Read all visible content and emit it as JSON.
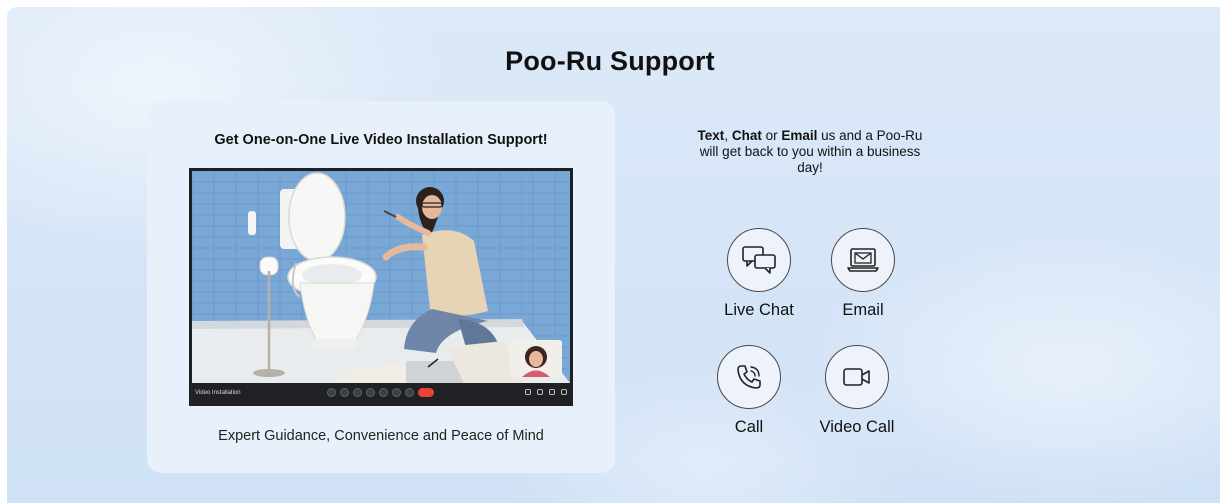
{
  "page": {
    "title": "Poo-Ru Support"
  },
  "video_support": {
    "heading": "Get One-on-One Live Video Installation Support!",
    "caption": "Expert Guidance, Convenience and Peace of Mind",
    "toolbar_label": "Video Installation"
  },
  "contact": {
    "intro_word_1": "Text",
    "intro_sep_1": ", ",
    "intro_word_2": "Chat",
    "intro_sep_2": " or ",
    "intro_word_3": "Email",
    "intro_rest": " us and a Poo-Ru will get back to you within a business day!",
    "options": [
      {
        "label": "Live Chat",
        "icon": "chat-bubbles-icon"
      },
      {
        "label": "Email",
        "icon": "envelope-laptop-icon"
      },
      {
        "label": "Call",
        "icon": "phone-icon"
      },
      {
        "label": "Video Call",
        "icon": "video-camera-icon"
      }
    ]
  }
}
